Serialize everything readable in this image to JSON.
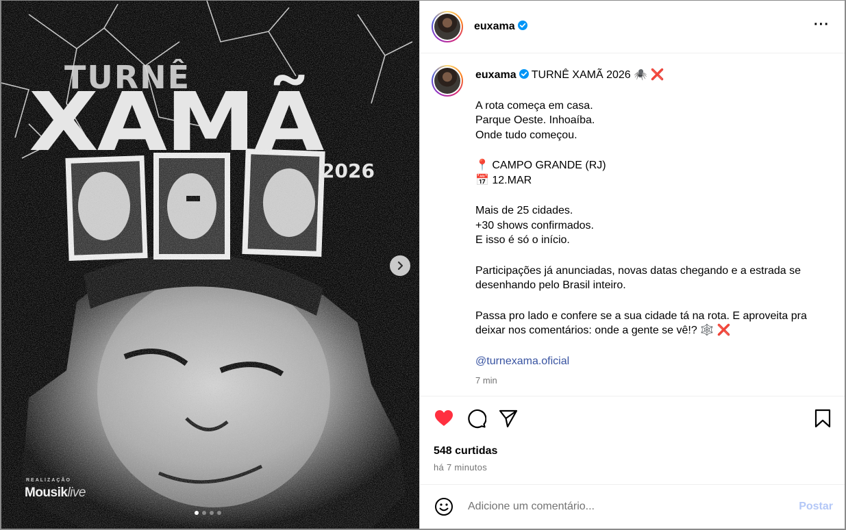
{
  "media": {
    "poster_turne": "TURNÊ",
    "poster_xama": "XAMÃ",
    "poster_year": "2026",
    "realizacao": "REALIZAÇÃO",
    "brand_main": "Mousik",
    "brand_live": "live",
    "carousel_total": 4,
    "carousel_active": 0
  },
  "header": {
    "username": "euxama",
    "verified": true,
    "more_icon": "more-horizontal-icon"
  },
  "caption": {
    "username": "euxama",
    "title": "TURNÊ XAMÃ 2026 🕷️ ❌",
    "paragraphs": [
      [
        "A rota começa em casa.",
        "Parque Oeste. Inhoaíba.",
        "Onde tudo começou."
      ],
      [
        "📍 CAMPO GRANDE (RJ)",
        "📅 12.MAR"
      ],
      [
        "Mais de 25 cidades.",
        "+30 shows confirmados.",
        "E isso é só o início."
      ],
      [
        "Participações já anunciadas, novas datas chegando e a estrada se desenhando pelo Brasil inteiro."
      ],
      [
        "Passa pro lado e confere se a sua cidade tá na rota. E aproveita pra deixar nos comentários: onde a gente se vê!? 🕸️ ❌"
      ]
    ],
    "mention": "@turnexama.oficial",
    "time": "7 min"
  },
  "actions": {
    "liked": true,
    "likes_text": "548 curtidas",
    "ago_text": "há 7 minutos"
  },
  "comment": {
    "placeholder": "Adicione um comentário...",
    "post_label": "Postar"
  },
  "colors": {
    "like": "#ff3040",
    "link": "#3853a1",
    "post_disabled": "#b3c7f7",
    "verified": "#0095f6"
  }
}
